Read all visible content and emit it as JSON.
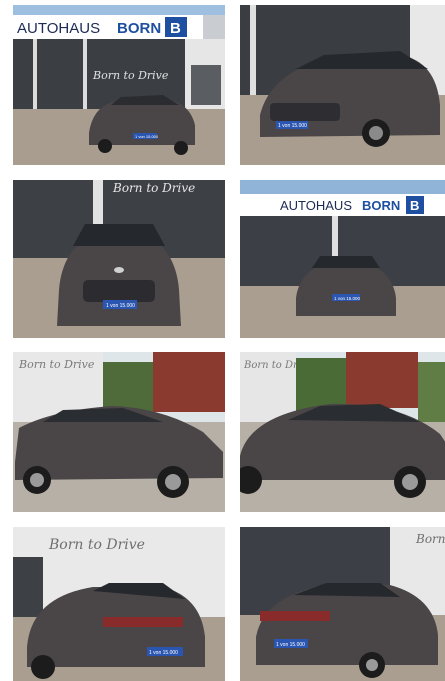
{
  "gallery": {
    "dealer_prefix": "AUTOHAUS",
    "dealer_name": "BORN",
    "dealer_logo_letter": "B",
    "slogan": "Born to Drive",
    "plate_text": "1 von 15.000",
    "car_brand_icon": "hyundai-logo-icon",
    "colors": {
      "car_body": "#4a4547",
      "dealer_blue": "#1f4fa0",
      "pavement": "#a89d8f",
      "sky": "#8fb4d8",
      "plate_blue": "#2a55b0"
    }
  }
}
